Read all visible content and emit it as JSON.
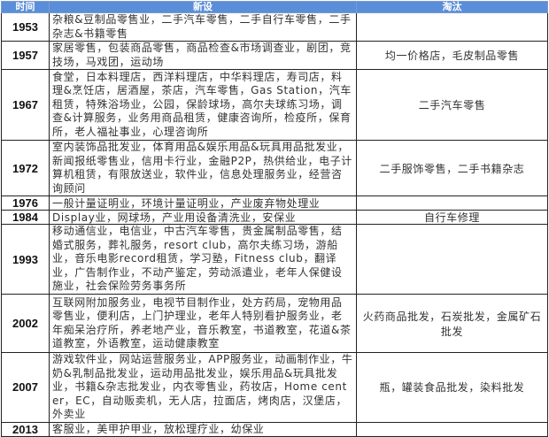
{
  "headers": {
    "year": "时间",
    "added": "新设",
    "removed": "淘汰"
  },
  "rows": [
    {
      "year": "1953",
      "added": "杂粮&豆制品零售业，二手汽车零售，二手自行车零售，二手杂志&书籍零售",
      "removed": ""
    },
    {
      "year": "1957",
      "added": "家居零售，包装商品零售，商品检查&市场调查业，剧团，竞技场，马戏团，运动场",
      "removed": "均一价格店，毛皮制品零售"
    },
    {
      "year": "1967",
      "added": "食堂，日本料理店，西洋料理店，中华料理店，寿司店，料理&烹饪店，居酒屋，茶店，汽车零售，Gas Station，汽车租赁，特殊浴场业，公园，保龄球场，高尔夫球练习场，调查&计算服务，业务用商品租赁，健康咨询所，检疫所，保育所，老人福祉事业，心理咨询所",
      "removed": "二手汽车零售"
    },
    {
      "year": "1972",
      "added": "室内装饰品批发业，体育用品&娱乐用品&玩具用品批发业，新闻报纸零售业，信用卡行业，金融P2P，热供给业，电子计算机租赁，有限放送业，软件业，信息处理服务业，经营咨询顾问",
      "removed": "二手服饰零售，二手书籍杂志"
    },
    {
      "year": "1976",
      "added": "一般计量证明业，环境计量证明业，产业废弃物处理业",
      "removed": ""
    },
    {
      "year": "1984",
      "added": "Display业，网球场，产业用设备清洗业，安保业",
      "removed": "自行车修理"
    },
    {
      "year": "1993",
      "added": "移动通信业，电信业，中古汽车零售，贵金属制品零售，结婚式服务，葬礼服务，resort club，高尔夫练习场，游船业，音乐电影record租赁，学习塾，Fitness club，翻译业，广告制作业，不动产鉴定，劳动派遣业，老年人保健设施业，社会保险劳务事务所",
      "removed": ""
    },
    {
      "year": "2002",
      "added": "互联网附加服务业，电视节目制作业，处方药局，宠物用品零售业，便利店，上门护理业，老年人特别看护服务业，老年痴呆治疗所，养老地产业，音乐教室，书道教室，花道&茶道教室，外语教室，运动健康教室",
      "removed": "火药商品批发，石炭批发，金属矿石批发"
    },
    {
      "year": "2007",
      "added": "游戏软件业，网站运营服务业，APP服务业，动画制作业，牛奶&乳制品批发业，运动用品批发业，娱乐用品&玩具批发业，书籍&杂志批发业，内衣零售业，药妆店，Home center，EC，自动贩卖机，无人店，拉面店，烤肉店，汉堡店，外卖业",
      "removed": "瓶，罐装食品批发，染料批发"
    },
    {
      "year": "2013",
      "added": "客服业，美甲护甲业，放松理疗业，幼保业",
      "removed": ""
    }
  ]
}
